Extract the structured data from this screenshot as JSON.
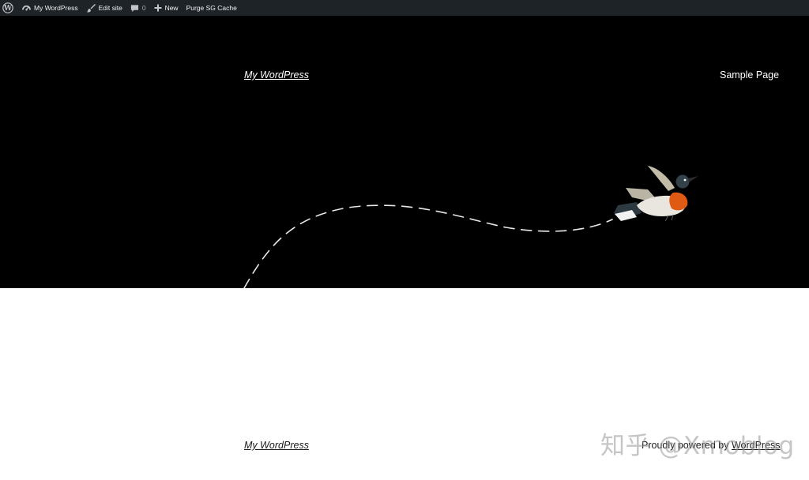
{
  "admin_bar": {
    "site_name": "My WordPress",
    "edit_site": "Edit site",
    "comments_count": "0",
    "new_label": "New",
    "purge_label": "Purge SG Cache",
    "background_color": "#1d2327"
  },
  "header": {
    "site_title": "My WordPress",
    "nav": {
      "sample_page": "Sample Page"
    },
    "background_color": "#000000"
  },
  "footer": {
    "site_title": "My WordPress",
    "powered_prefix": "Proudly powered by ",
    "powered_link": "WordPress"
  },
  "watermark": {
    "text": "知乎 @Xmoblog"
  },
  "icons": {
    "wp_logo": "wordpress-logo-icon",
    "dashboard": "dashboard-gauge-icon",
    "edit": "brush-icon",
    "comments": "comment-bubble-icon",
    "new": "plus-icon",
    "hero_art": "bird-illustration"
  }
}
